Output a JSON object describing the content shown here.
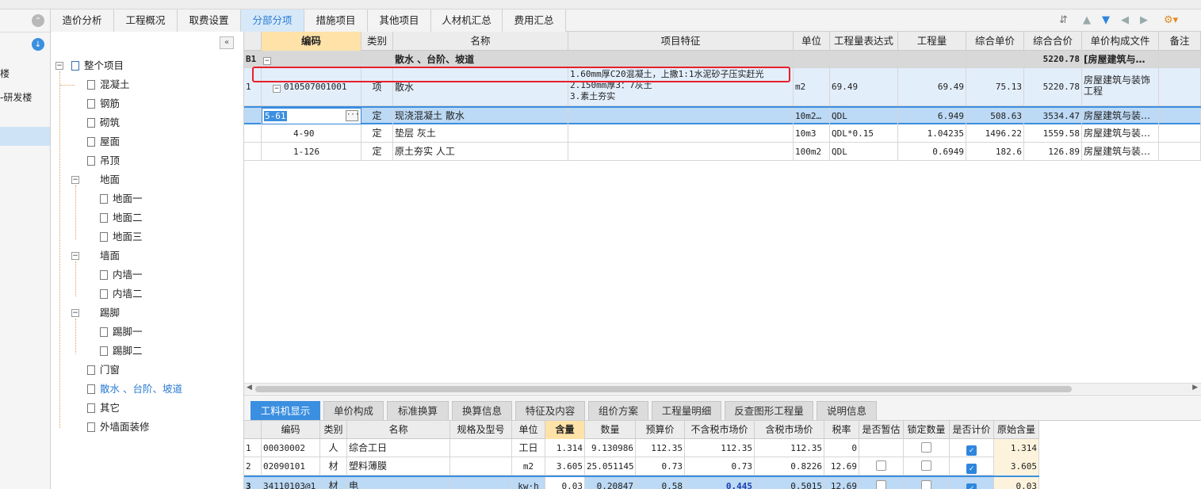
{
  "left_nav": {
    "items": [
      "楼",
      "-研发楼"
    ]
  },
  "tabs": [
    {
      "label": "造价分析",
      "active": false
    },
    {
      "label": "工程概况",
      "active": false
    },
    {
      "label": "取费设置",
      "active": false
    },
    {
      "label": "分部分项",
      "active": true
    },
    {
      "label": "措施项目",
      "active": false
    },
    {
      "label": "其他项目",
      "active": false
    },
    {
      "label": "人材机汇总",
      "active": false
    },
    {
      "label": "费用汇总",
      "active": false
    }
  ],
  "tree": {
    "root": "整个项目",
    "items": {
      "concrete": "混凝土",
      "rebar": "钢筋",
      "masonry": "砌筑",
      "roof": "屋面",
      "ceiling": "吊顶",
      "floor": "地面",
      "floor1": "地面一",
      "floor2": "地面二",
      "floor3": "地面三",
      "wall": "墙面",
      "wall_in1": "内墙一",
      "wall_in2": "内墙二",
      "skirting": "踢脚",
      "skirting1": "踢脚一",
      "skirting2": "踢脚二",
      "doors": "门窗",
      "apron": "散水 、台阶、坡道",
      "other": "其它",
      "exterior": "外墙面装修"
    }
  },
  "grid": {
    "headers": [
      "编码",
      "类别",
      "名称",
      "项目特征",
      "单位",
      "工程量表达式",
      "工程量",
      "综合单价",
      "综合合价",
      "单价构成文件",
      "备注"
    ],
    "section": {
      "no": "B1",
      "name": "散水 、台阶、坡道",
      "total": "5220.78",
      "file": "[房屋建筑与…"
    },
    "item": {
      "no": "1",
      "code": "010507001001",
      "type": "项",
      "name": "散水",
      "feature1": "1.60mm厚C20混凝土，上撒1:1水泥砂子压实赶光",
      "feature2": "2.150mm厚3：7灰土",
      "feature3": "3.素土夯实",
      "unit": "m2",
      "expr": "69.49",
      "qty": "69.49",
      "price": "75.13",
      "total": "5220.78",
      "file": "房屋建筑与装饰工程"
    },
    "subs": [
      {
        "code": "5-61",
        "type": "定",
        "name": "现浇混凝土 散水",
        "unit": "10m2…",
        "expr": "QDL",
        "qty": "6.949",
        "price": "508.63",
        "total": "3534.47",
        "file": "房屋建筑与装…"
      },
      {
        "code": "4-90",
        "type": "定",
        "name": "垫层 灰土",
        "unit": "10m3",
        "expr": "QDL*0.15",
        "qty": "1.04235",
        "price": "1496.22",
        "total": "1559.58",
        "file": "房屋建筑与装…"
      },
      {
        "code": "1-126",
        "type": "定",
        "name": "原土夯实 人工",
        "unit": "100m2",
        "expr": "QDL",
        "qty": "0.6949",
        "price": "182.6",
        "total": "126.89",
        "file": "房屋建筑与装…"
      }
    ]
  },
  "bottom_tabs": [
    {
      "label": "工料机显示",
      "active": true
    },
    {
      "label": "单价构成",
      "active": false
    },
    {
      "label": "标准换算",
      "active": false
    },
    {
      "label": "换算信息",
      "active": false
    },
    {
      "label": "特征及内容",
      "active": false
    },
    {
      "label": "组价方案",
      "active": false
    },
    {
      "label": "工程量明细",
      "active": false
    },
    {
      "label": "反查图形工程量",
      "active": false
    },
    {
      "label": "说明信息",
      "active": false
    }
  ],
  "resource": {
    "headers": [
      "编码",
      "类别",
      "名称",
      "规格及型号",
      "单位",
      "含量",
      "数量",
      "预算价",
      "不含税市场价",
      "含税市场价",
      "税率",
      "是否暂估",
      "锁定数量",
      "是否计价",
      "原始含量"
    ],
    "rows": [
      {
        "no": "1",
        "code": "00030002",
        "type": "人",
        "name": "综合工日",
        "spec": "",
        "unit": "工日",
        "content": "1.314",
        "qty": "9.130986",
        "budget": "112.35",
        "ex_tax": "112.35",
        "in_tax": "112.35",
        "rate": "0",
        "est": "",
        "lock": false,
        "priced": true,
        "orig": "1.314"
      },
      {
        "no": "2",
        "code": "02090101",
        "type": "材",
        "name": "塑料薄膜",
        "spec": "",
        "unit": "m2",
        "content": "3.605",
        "qty": "25.051145",
        "budget": "0.73",
        "ex_tax": "0.73",
        "in_tax": "0.8226",
        "rate": "12.69",
        "est": false,
        "lock": false,
        "priced": true,
        "orig": "3.605"
      },
      {
        "no": "3",
        "code": "34110103@1",
        "type": "材",
        "name": "电",
        "spec": "",
        "unit": "kw·h",
        "content": "0.03",
        "qty": "0.20847",
        "budget": "0.58",
        "ex_tax": "0.445",
        "in_tax": "0.5015",
        "rate": "12.69",
        "est": false,
        "lock": false,
        "priced": true,
        "orig": "0.03"
      }
    ]
  },
  "colors": {
    "accent": "#3b8fe0",
    "selected_row": "#bcd9f5",
    "header_sel": "#ffe2a8",
    "red_box": "#e8202a"
  }
}
